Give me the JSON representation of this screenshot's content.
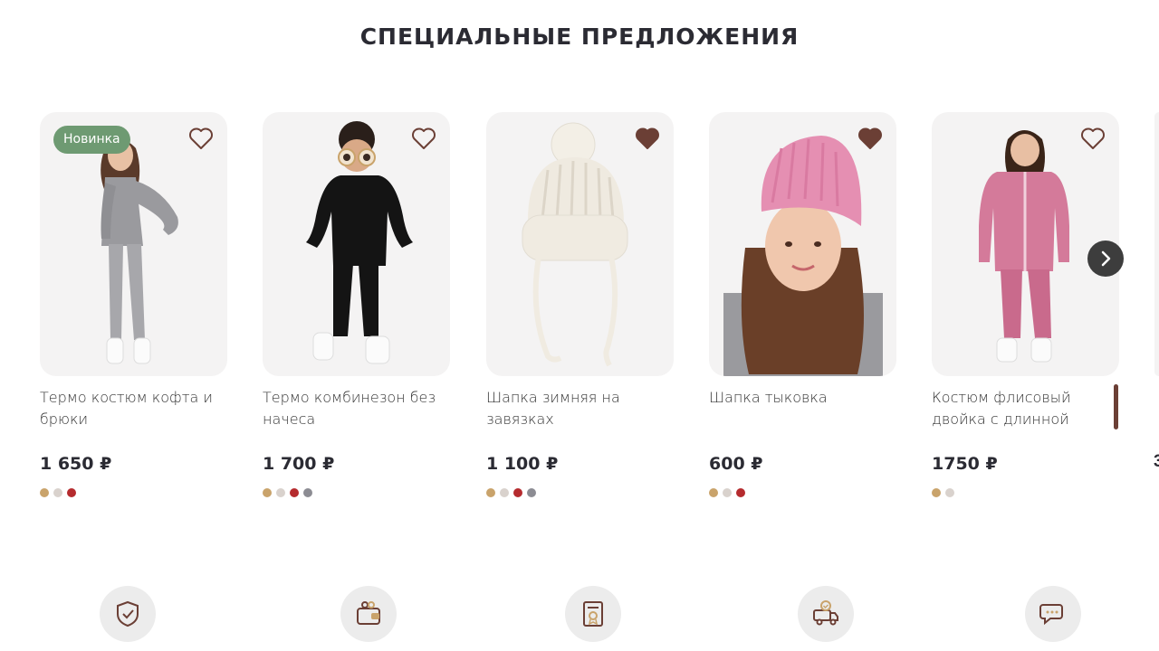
{
  "section": {
    "title": "СПЕЦИАЛЬНЫЕ ПРЕДЛОЖЕНИЯ"
  },
  "colors": {
    "badge": "#6e9a72",
    "favorite_active": "#6b3f35",
    "price": "#2b2b33"
  },
  "products": [
    {
      "badge": "Новинка",
      "title": "Термо костюм кофта и брюки",
      "price": "1 650 ₽",
      "favorite": false,
      "color_options": [
        "#c9a36b",
        "#d9d2cd",
        "#b52b2e"
      ]
    },
    {
      "badge": "",
      "title": "Термо комбинезон без начеса",
      "price": "1 700 ₽",
      "favorite": false,
      "color_options": [
        "#c9a36b",
        "#d9d2cd",
        "#b52b2e",
        "#8c8c93"
      ]
    },
    {
      "badge": "",
      "title": "Шапка зимняя на завязках",
      "price": "1 100 ₽",
      "favorite": true,
      "color_options": [
        "#c9a36b",
        "#d9d2cd",
        "#b52b2e",
        "#8c8c93"
      ]
    },
    {
      "badge": "",
      "title": "Шапка тыковка",
      "price": "600 ₽",
      "favorite": true,
      "color_options": [
        "#c9a36b",
        "#d9d2cd",
        "#b52b2e"
      ]
    },
    {
      "badge": "",
      "title": "Костюм флисовый двойка с длинной молнией",
      "price": "1750 ₽",
      "favorite": false,
      "color_options": [
        "#c9a36b",
        "#d9d2cd"
      ]
    }
  ],
  "partial_next": {
    "price": "3"
  },
  "icons": {
    "next": "chevron-right-icon",
    "features": [
      "shield-check-icon",
      "wallet-icon",
      "certificate-icon",
      "delivery-truck-icon",
      "chat-bubbles-icon"
    ]
  }
}
